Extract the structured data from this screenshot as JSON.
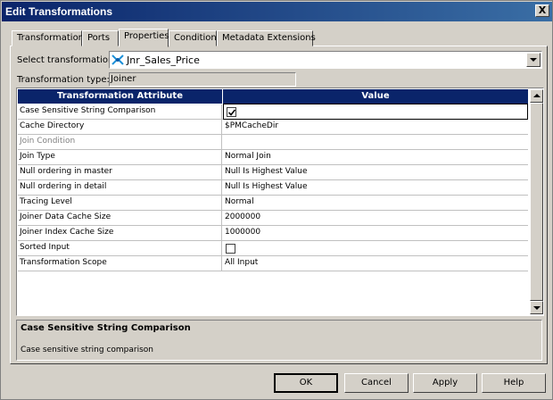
{
  "window": {
    "title": "Edit Transformations",
    "close_glyph": "X"
  },
  "tabs": [
    {
      "label": "Transformation"
    },
    {
      "label": "Ports"
    },
    {
      "label": "Properties"
    },
    {
      "label": "Condition"
    },
    {
      "label": "Metadata Extensions"
    }
  ],
  "active_tab": "Properties",
  "select_transformation": {
    "label": "Select transformation:",
    "value": "Jnr_Sales_Price",
    "icon": "joiner-icon"
  },
  "transformation_type": {
    "label": "Transformation type:",
    "value": "Joiner"
  },
  "grid": {
    "headers": [
      "Transformation Attribute",
      "Value"
    ],
    "rows": [
      {
        "attribute": "Case Sensitive String Comparison",
        "value": "",
        "checkbox": true,
        "checked": true
      },
      {
        "attribute": "Cache Directory",
        "value": "$PMCacheDir"
      },
      {
        "attribute": "Join Condition",
        "value": "",
        "disabled": true
      },
      {
        "attribute": "Join Type",
        "value": "Normal Join"
      },
      {
        "attribute": "Null ordering in master",
        "value": "Null Is Highest Value"
      },
      {
        "attribute": "Null ordering in detail",
        "value": "Null Is Highest Value"
      },
      {
        "attribute": "Tracing Level",
        "value": "Normal"
      },
      {
        "attribute": "Joiner Data Cache Size",
        "value": "2000000"
      },
      {
        "attribute": "Joiner Index Cache Size",
        "value": "1000000"
      },
      {
        "attribute": "Sorted Input",
        "value": "",
        "checkbox": true,
        "checked": false
      },
      {
        "attribute": "Transformation Scope",
        "value": "All Input"
      }
    ]
  },
  "description": {
    "title": "Case Sensitive String Comparison",
    "text": "Case sensitive string comparison"
  },
  "buttons": {
    "ok": "OK",
    "cancel": "Cancel",
    "apply": "Apply",
    "help": "Help"
  },
  "colors": {
    "header_bg": "#0a246a",
    "title_gradient_start": "#0a246a",
    "title_gradient_end": "#3a6ea5"
  }
}
